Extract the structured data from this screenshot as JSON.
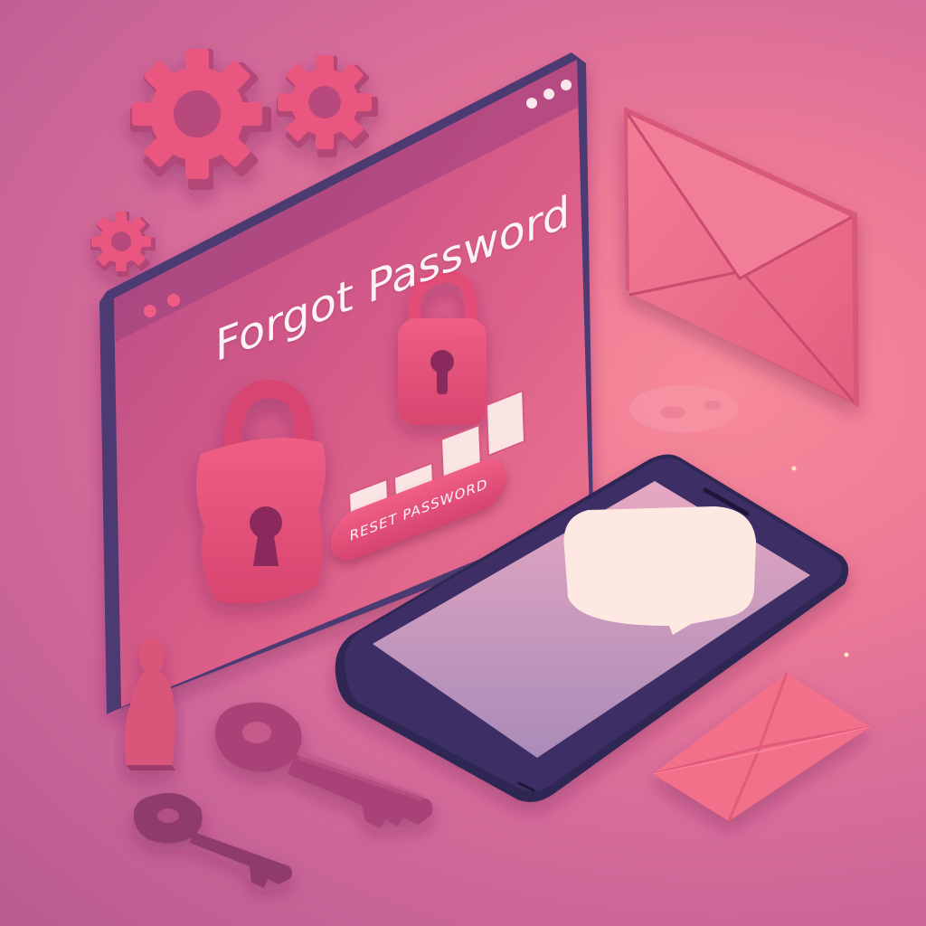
{
  "browser_window": {
    "title": "Forgot Password",
    "reset_button_label": "RESET PASSWORD"
  },
  "colors": {
    "background": "#ee7b96",
    "panel": "#cf5a86",
    "accent": "#e24a76",
    "phone_frame": "#3e2f66",
    "phone_screen": "#c890b4"
  },
  "icons": [
    "gear-icon",
    "lock-icon",
    "envelope-icon",
    "smartphone-icon",
    "chat-bubble-icon",
    "key-icon",
    "person-silhouette-icon"
  ]
}
